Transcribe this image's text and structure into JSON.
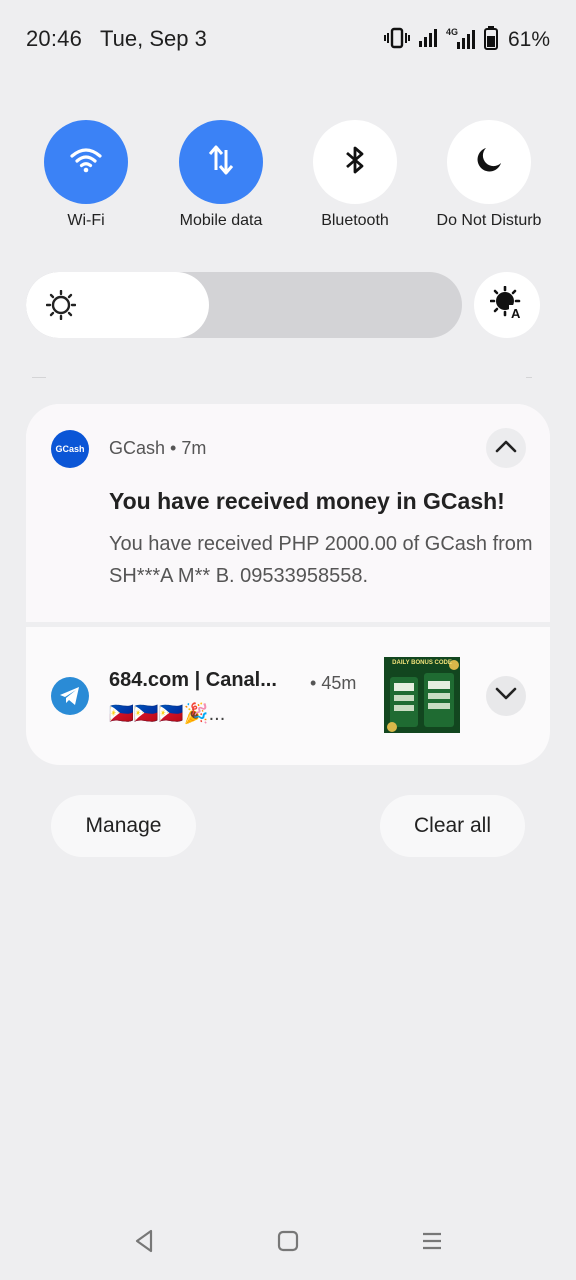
{
  "status_bar": {
    "time": "20:46",
    "date": "Tue, Sep 3",
    "battery_percent": "61%",
    "network_label": "4G",
    "icons": [
      "vibrate-icon",
      "signal-icon",
      "signal-4g-icon",
      "battery-icon"
    ]
  },
  "quick_settings": {
    "tiles": [
      {
        "label": "Wi-Fi",
        "icon": "wifi-icon",
        "active": true
      },
      {
        "label": "Mobile data",
        "icon": "mobile-data-icon",
        "active": true
      },
      {
        "label": "Bluetooth",
        "icon": "bluetooth-icon",
        "active": false
      },
      {
        "label": "Do Not Disturb",
        "icon": "moon-icon",
        "active": false
      }
    ],
    "brightness_level": 0.42,
    "accent_color": "#3b82f6"
  },
  "notifications": [
    {
      "app": "GCash",
      "time": "7m",
      "logo_text": "GCash",
      "title": "You have received money in GCash!",
      "body": "You have received PHP 2000.00 of GCash from SH***A M** B. 09533958558."
    },
    {
      "app": "684.com | Canal...",
      "time": "45m",
      "text": "🇵🇭🇵🇭🇵🇭🎉...",
      "thumbnail_title": "DAILY BONUS CODE"
    }
  ],
  "actions": {
    "manage": "Manage",
    "clear_all": "Clear all"
  },
  "nav": {
    "icons": [
      "back-icon",
      "home-icon",
      "recents-icon"
    ]
  }
}
